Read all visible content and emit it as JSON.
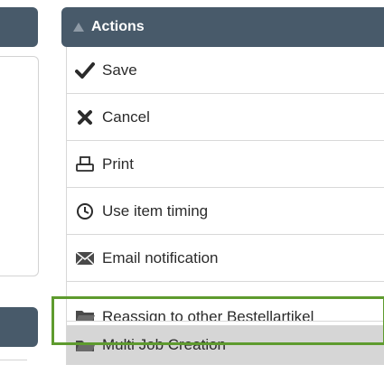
{
  "actions_panel": {
    "title": "Actions",
    "items": [
      {
        "label": "Save",
        "icon": "checkmark-icon"
      },
      {
        "label": "Cancel",
        "icon": "x-icon"
      },
      {
        "label": "Print",
        "icon": "printer-icon"
      },
      {
        "label": "Use item timing",
        "icon": "clock-icon"
      },
      {
        "label": "Email notification",
        "icon": "envelope-icon"
      },
      {
        "label": "Reassign to other Bestellartikel",
        "icon": "folder-icon"
      },
      {
        "label": "Multi Job Creation",
        "icon": "folder-icon"
      }
    ]
  },
  "colors": {
    "header_bg": "#485a6a",
    "highlight_border": "#5e9b2e",
    "selected_bg": "#d6d6d6"
  }
}
